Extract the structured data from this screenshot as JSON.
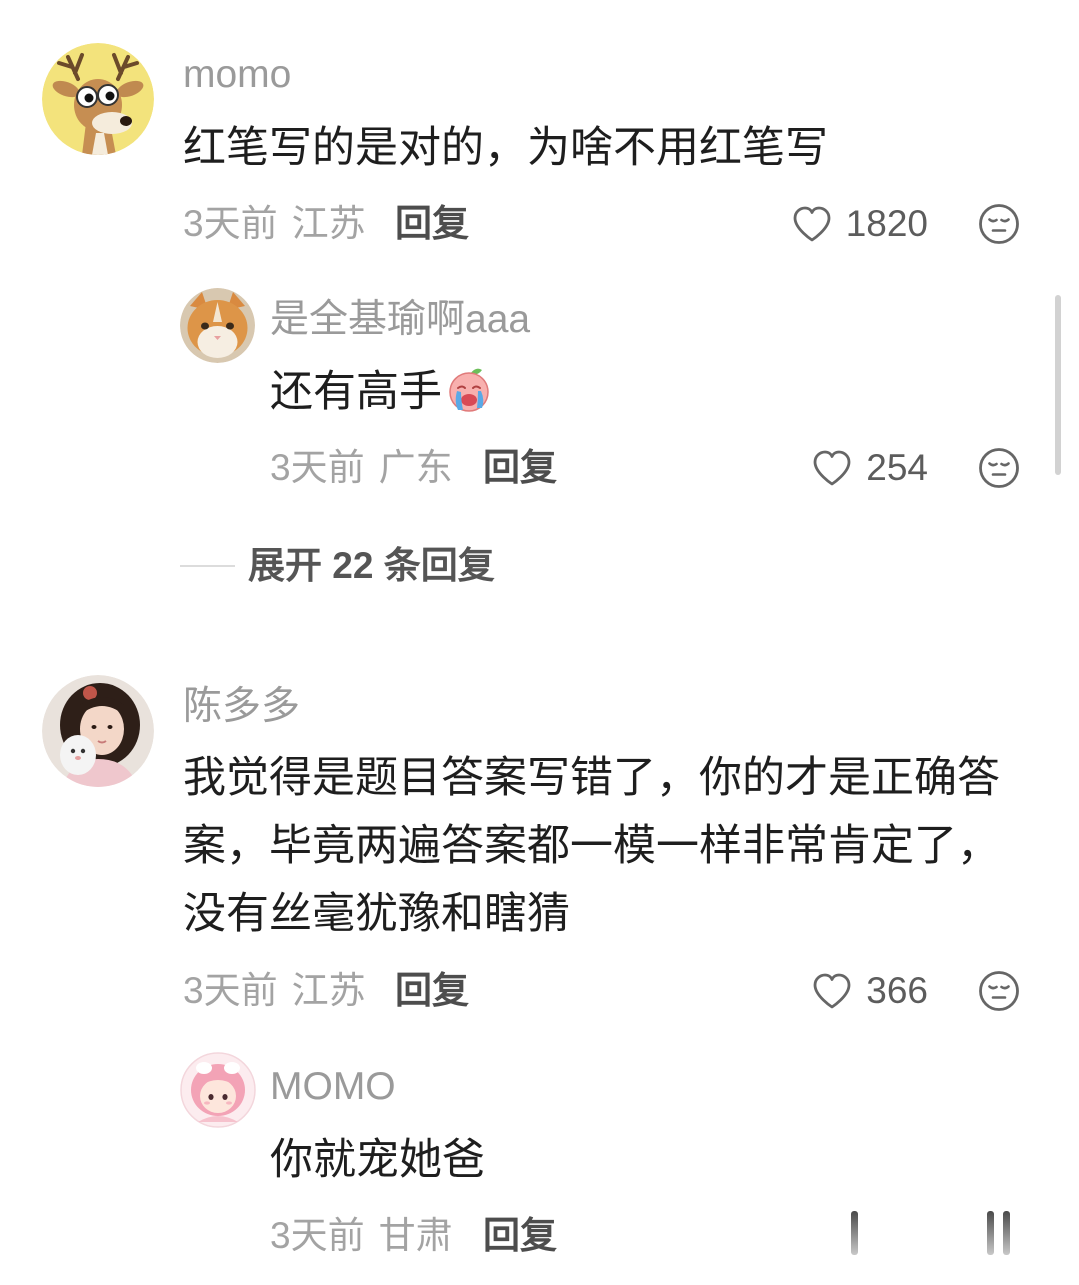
{
  "colors": {
    "background": "#ffffff",
    "comment_text": "#1e1e1e",
    "username": "#9a9a9a",
    "meta": "#a3a3a3",
    "reply_action": "#4d4d4d",
    "icon": "#666666"
  },
  "icons": {
    "like": "heart-outline-icon",
    "dislike": "neutral-face-icon"
  },
  "comments": [
    {
      "username": "momo",
      "avatar_icon": "deer-cartoon-avatar",
      "text": "红笔写的是对的，为啥不用红笔写",
      "time": "3天前",
      "location": "江苏",
      "reply_label": "回复",
      "likes": "1820",
      "expand_label": "展开 22 条回复",
      "replies": [
        {
          "username": "是全基瑜啊aaa",
          "avatar_icon": "cat-photo-avatar",
          "text": "还有高手",
          "emoji_icon": "crying-face-emoji",
          "time": "3天前",
          "location": "广东",
          "reply_label": "回复",
          "likes": "254"
        }
      ]
    },
    {
      "username": "陈多多",
      "avatar_icon": "girl-photo-avatar",
      "text": "我觉得是题目答案写错了，你的才是正确答案，毕竟两遍答案都一模一样非常肯定了，没有丝毫犹豫和瞎猜",
      "time": "3天前",
      "location": "江苏",
      "reply_label": "回复",
      "likes": "366",
      "replies": [
        {
          "username": "MOMO",
          "avatar_icon": "pink-character-avatar",
          "text": "你就宠她爸",
          "time": "3天前",
          "location": "甘肃",
          "reply_label": "回复"
        }
      ]
    }
  ]
}
